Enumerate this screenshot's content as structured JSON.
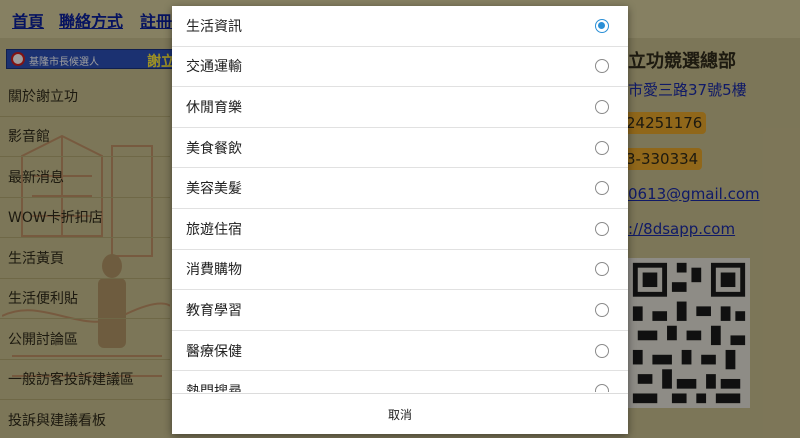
{
  "top_nav": {
    "home": "首頁",
    "contact": "聯絡方式",
    "register": "註冊"
  },
  "banner": {
    "caption": "基隆市長候選人",
    "name": "謝立功"
  },
  "sidebar": {
    "items": [
      {
        "label": "關於謝立功"
      },
      {
        "label": "影音館"
      },
      {
        "label": "最新消息"
      },
      {
        "label": "WOW卡折扣店"
      },
      {
        "label": "生活黃頁"
      },
      {
        "label": "生活便利貼"
      },
      {
        "label": "公開討論區"
      },
      {
        "label": "一般訪客投訴建議區"
      },
      {
        "label": "投訴與建議看板"
      }
    ]
  },
  "info": {
    "title": "立功競選總部",
    "address": "市愛三路37號5樓",
    "phone": "24251176",
    "fax": "3-330334",
    "email": "0613@gmail.com",
    "website": "://8dsapp.com"
  },
  "dialog": {
    "options": [
      {
        "label": "生活資訊",
        "selected": true
      },
      {
        "label": "交通運輸",
        "selected": false
      },
      {
        "label": "休閒育樂",
        "selected": false
      },
      {
        "label": "美食餐飲",
        "selected": false
      },
      {
        "label": "美容美髮",
        "selected": false
      },
      {
        "label": "旅遊住宿",
        "selected": false
      },
      {
        "label": "消費購物",
        "selected": false
      },
      {
        "label": "教育學習",
        "selected": false
      },
      {
        "label": "醫療保健",
        "selected": false
      },
      {
        "label": "熱門搜尋",
        "selected": false
      }
    ],
    "cancel_label": "取消"
  },
  "colors": {
    "accent": "#2a8fd6",
    "link": "#1a2aa6",
    "nav_link": "#0b1f9c",
    "highlight": "#e8a62a"
  }
}
